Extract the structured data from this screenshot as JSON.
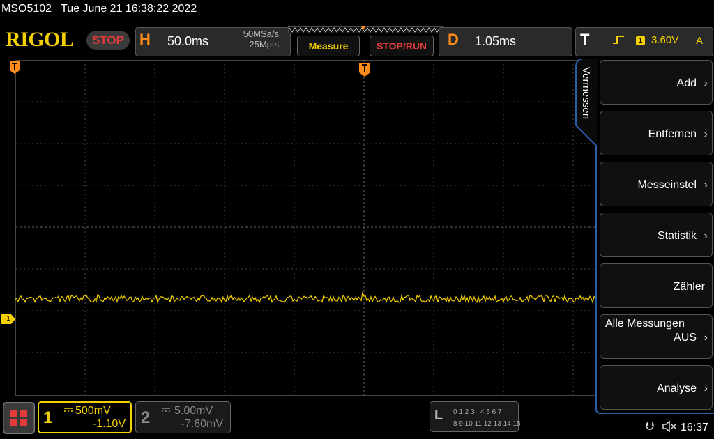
{
  "title_bar": {
    "model": "MSO5102",
    "datetime": "Tue June 21 16:38:22 2022"
  },
  "header": {
    "brand": "RIGOL",
    "run_state": "STOP",
    "horizontal": {
      "letter": "H",
      "timebase": "50.0ms",
      "sample_rate": "50MSa/s",
      "memory_depth": "25Mpts"
    },
    "measure_button": "Measure",
    "stoprun_button": "STOP/RUN",
    "delay": {
      "letter": "D",
      "value": "1.05ms"
    },
    "trigger": {
      "letter": "T",
      "source": "1",
      "level": "3.60V",
      "mode": "A"
    }
  },
  "side_menu": {
    "title": "Vermessen",
    "items": [
      {
        "label": "Add"
      },
      {
        "label": "Entfernen"
      },
      {
        "label": "Messeinstel"
      },
      {
        "label": "Statistik"
      },
      {
        "label": "Zähler"
      },
      {
        "title": "Alle Messungen",
        "label": "AUS"
      },
      {
        "label": "Analyse"
      }
    ]
  },
  "screen": {
    "ch1_marker": "1"
  },
  "channels": {
    "ch1": {
      "number": "1",
      "scale": "500mV",
      "offset": "-1.10V"
    },
    "ch2": {
      "number": "2",
      "scale": "5.00mV",
      "offset": "-7.60mV"
    }
  },
  "logic_analyzer": {
    "letter": "L",
    "row1": "0 1 2 3   4 5 6 7",
    "row2": "8 9 10 11 12 13 14 15"
  },
  "status": {
    "time": "16:37"
  },
  "colors": {
    "ch1": "#f5d000",
    "accent_orange": "#ff8c1a",
    "stop_red": "#e23b3b",
    "menu_blue": "#2a5ea8"
  }
}
